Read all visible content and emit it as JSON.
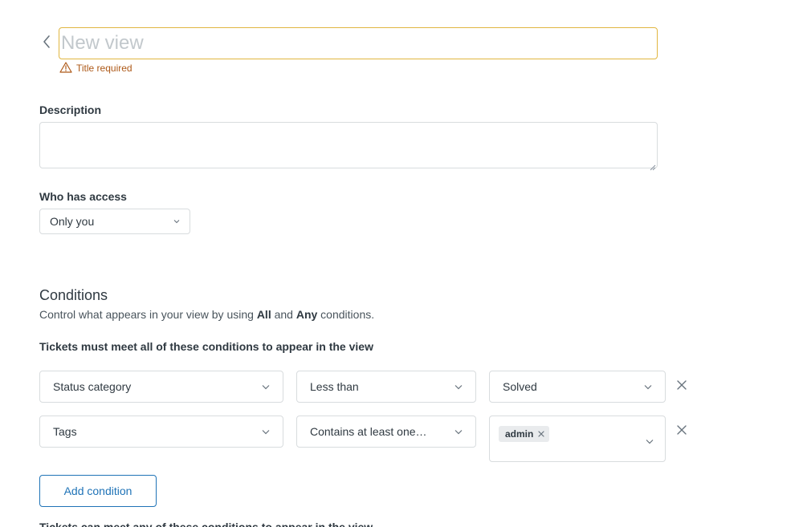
{
  "title_field": {
    "placeholder": "New view",
    "value": ""
  },
  "title_error": "Title required",
  "description": {
    "label": "Description",
    "value": ""
  },
  "access": {
    "label": "Who has access",
    "selected": "Only you"
  },
  "conditions": {
    "title": "Conditions",
    "desc_prefix": "Control what appears in your view by using ",
    "all_word": "All",
    "desc_middle": " and ",
    "any_word": "Any",
    "desc_suffix": " conditions.",
    "all_heading": "Tickets must meet all of these conditions to appear in the view",
    "rows": [
      {
        "field": "Status category",
        "operator": "Less than",
        "value": "Solved"
      },
      {
        "field": "Tags",
        "operator": "Contains at least one…",
        "tags": [
          "admin"
        ]
      }
    ],
    "add_label": "Add condition",
    "next_heading": "Tickets can meet any of these conditions to appear in the view"
  },
  "colors": {
    "warning": "#ad5918",
    "warning_border": "#e1b640",
    "primary": "#1f73b7",
    "border": "#d8dcde",
    "text": "#2f3941"
  }
}
